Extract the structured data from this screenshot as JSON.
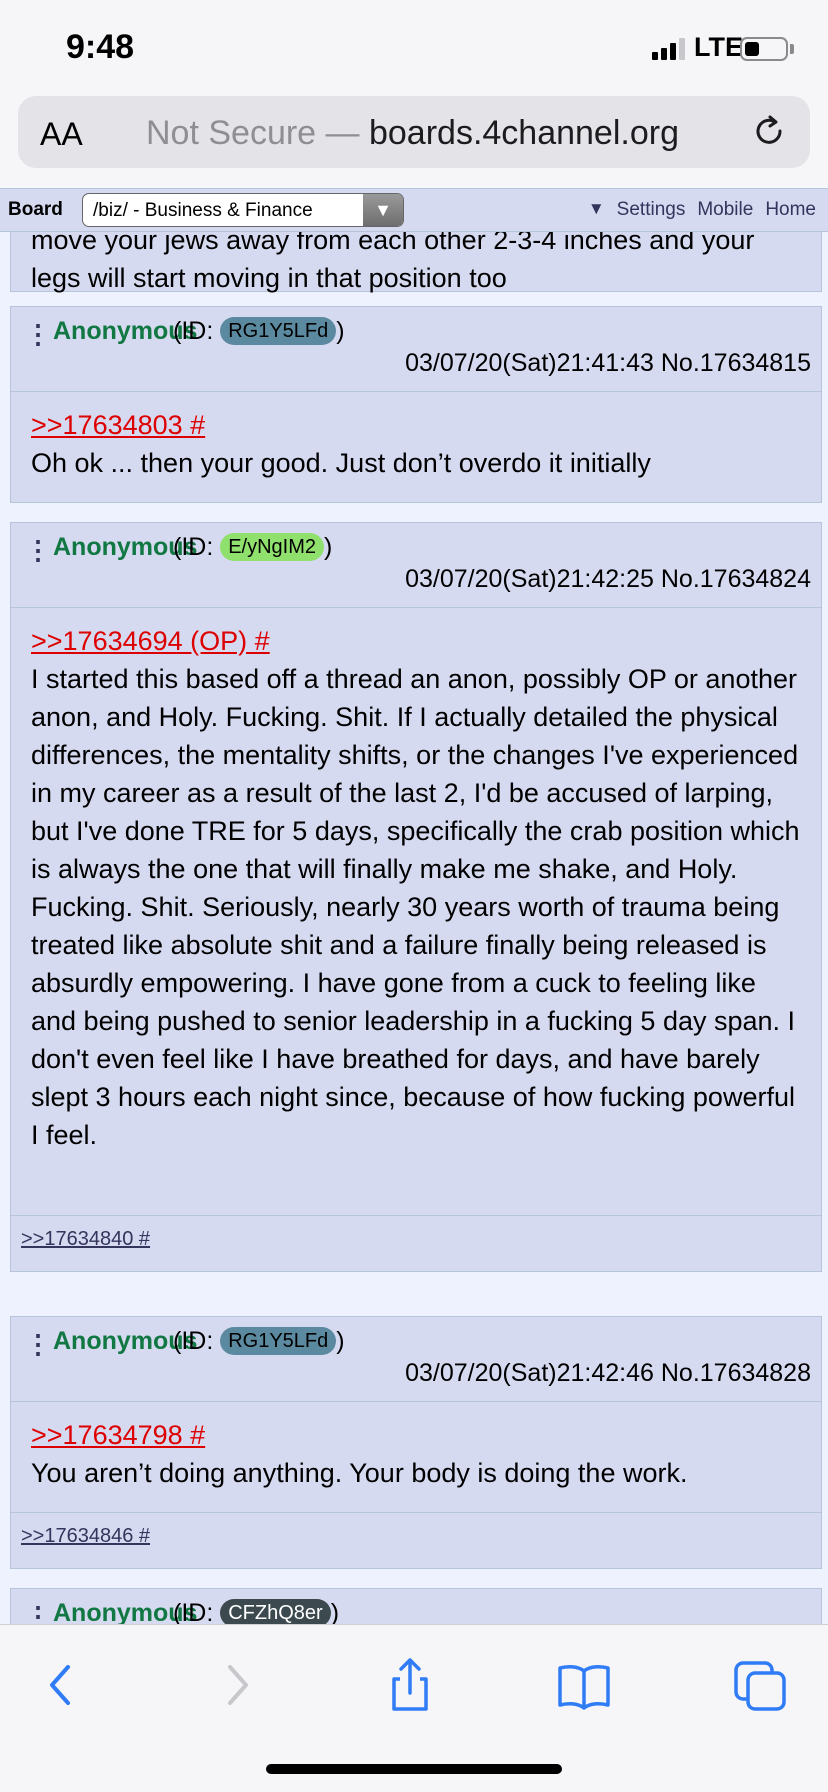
{
  "status_bar": {
    "time": "9:48",
    "network": "LTE"
  },
  "browser": {
    "text_size_button": "AA",
    "security_label": "Not Secure —",
    "host": "boards.4channel.org"
  },
  "board_bar": {
    "label": "Board",
    "selected_board": "/biz/ - Business & Finance",
    "links": {
      "triangle": "▼",
      "settings": "Settings",
      "mobile": "Mobile",
      "home": "Home"
    }
  },
  "truncated_post_text": "move your jews away from each other 2-3-4 inches and your legs will start moving in that position too",
  "posts": [
    {
      "name": "Anonymous",
      "id_prefix": "(ID: ",
      "id": "RG1Y5LFd",
      "id_suffix": ")",
      "id_color": "#5b8aa0",
      "meta": "03/07/20(Sat)21:41:43 No.17634815",
      "quote_link": ">>17634803 #",
      "text": "Oh ok ... then your good. Just don’t overdo it initially",
      "backlinks": ""
    },
    {
      "name": "Anonymous",
      "id_prefix": "(ID: ",
      "id": "E/yNgIM2",
      "id_suffix": ")",
      "id_color": "#90e06e",
      "meta": "03/07/20(Sat)21:42:25 No.17634824",
      "quote_link": ">>17634694 (OP) #",
      "text": "I started this based off a thread an anon, possibly OP or another anon, and Holy. Fucking. Shit. If I actually detailed the physical differences, the mentality shifts, or the changes I've experienced in my career as a result of the last 2, I'd be accused of larping, but I've done TRE for 5 days, specifically the crab position which is always the one that will finally make me shake, and Holy. Fucking. Shit. Seriously, nearly 30 years worth of trauma being treated like absolute shit and a failure finally being released is absurdly empowering. I have gone from a cuck to feeling like and being pushed to senior leadership in a fucking 5 day span. I don't even feel like I have breathed for days, and have barely slept 3 hours each night since, because of how fucking powerful I feel.",
      "backlinks": ">>17634840 #"
    },
    {
      "name": "Anonymous",
      "id_prefix": "(ID: ",
      "id": "RG1Y5LFd",
      "id_suffix": ")",
      "id_color": "#5b8aa0",
      "meta": "03/07/20(Sat)21:42:46 No.17634828",
      "quote_link": ">>17634798 #",
      "text": "You aren’t doing anything. Your body is doing the work.",
      "backlinks": ">>17634846 #"
    },
    {
      "name": "Anonymous",
      "id_prefix": "(ID: ",
      "id": "CFZhQ8er",
      "id_suffix": ")",
      "id_color": "#3c4a50"
    }
  ],
  "toolbar": {
    "icons": [
      "back-icon",
      "forward-icon",
      "share-icon",
      "bookmarks-icon",
      "tabs-icon"
    ]
  }
}
